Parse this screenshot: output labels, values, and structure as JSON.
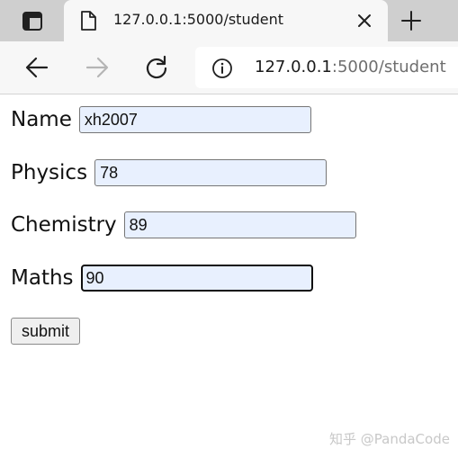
{
  "browser": {
    "tab": {
      "title": "127.0.0.1:5000/student"
    },
    "address": {
      "host": "127.0.0.1",
      "rest": ":5000/student"
    }
  },
  "form": {
    "fields": [
      {
        "label": "Name",
        "value": "xh2007"
      },
      {
        "label": "Physics",
        "value": "78"
      },
      {
        "label": "Chemistry",
        "value": "89"
      },
      {
        "label": "Maths",
        "value": "90"
      }
    ],
    "submit_label": "submit"
  },
  "watermark": "知乎 @PandaCode",
  "colors": {
    "autofill_bg": "#e8f0fe",
    "tabstrip_bg": "#cfcfcf",
    "toolbar_bg": "#f7f7f7"
  }
}
